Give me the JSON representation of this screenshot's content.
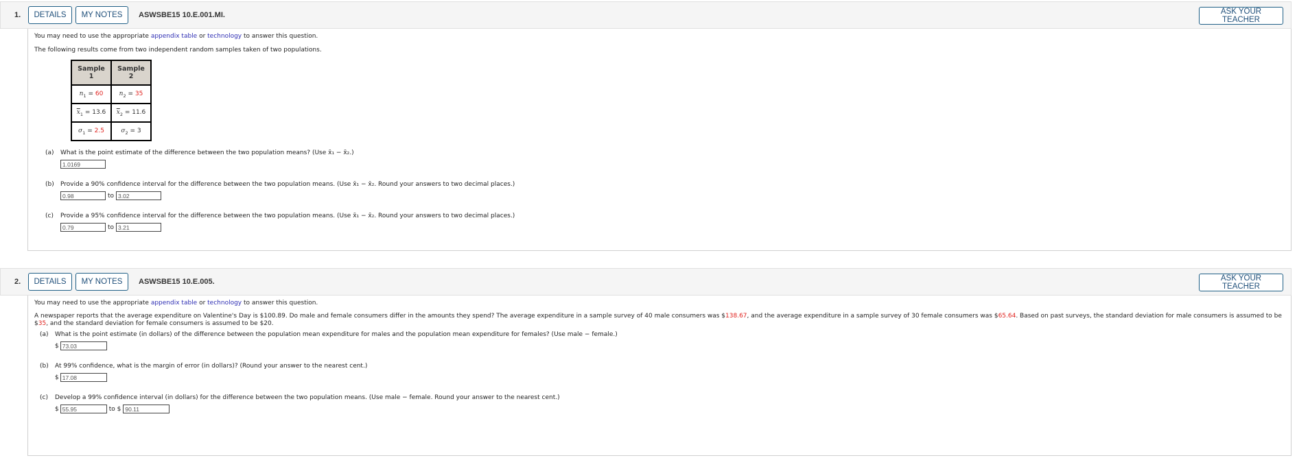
{
  "questions": [
    {
      "number": "1.",
      "details_label": "DETAILS",
      "notes_label": "MY NOTES",
      "id": "ASWSBE15 10.E.001.MI.",
      "ask_label": "ASK YOUR TEACHER",
      "intro_pre": "You may need to use the appropriate ",
      "intro_link1": "appendix table",
      "intro_mid": " or ",
      "intro_link2": "technology",
      "intro_post": " to answer this question.",
      "statement": "The following results come from two independent random samples taken of two populations.",
      "table": {
        "headers": [
          "Sample 1",
          "Sample 2"
        ],
        "rows": [
          {
            "s1_sym": "n",
            "s1_sub": "1",
            "s1_val": "60",
            "s1_red": true,
            "s2_sym": "n",
            "s2_sub": "2",
            "s2_val": "35",
            "s2_red": true
          },
          {
            "s1_sym": "x",
            "s1_sub": "1",
            "s1_val": "13.6",
            "s1_red": false,
            "s2_sym": "x",
            "s2_sub": "2",
            "s2_val": "11.6",
            "s2_red": false
          },
          {
            "s1_sym": "σ",
            "s1_sub": "1",
            "s1_val": "2.5",
            "s1_red": true,
            "s2_sym": "σ",
            "s2_sub": "2",
            "s2_val": "3",
            "s2_red": false
          }
        ]
      },
      "parts": [
        {
          "label": "(a)",
          "text": "What is the point estimate of the difference between the two population means? (Use x̄₁ − x̄₂.)",
          "answers": [
            "1.0169"
          ],
          "to_label": ""
        },
        {
          "label": "(b)",
          "text": "Provide a 90% confidence interval for the difference between the two population means. (Use x̄₁ − x̄₂. Round your answers to two decimal places.)",
          "answers": [
            "0.98",
            "3.02"
          ],
          "to_label": "to"
        },
        {
          "label": "(c)",
          "text": "Provide a 95% confidence interval for the difference between the two population means. (Use x̄₁ − x̄₂. Round your answers to two decimal places.)",
          "answers": [
            "0.79",
            "3.21"
          ],
          "to_label": "to"
        }
      ]
    },
    {
      "number": "2.",
      "details_label": "DETAILS",
      "notes_label": "MY NOTES",
      "id": "ASWSBE15 10.E.005.",
      "ask_label": "ASK YOUR TEACHER",
      "intro_pre": "You may need to use the appropriate ",
      "intro_link1": "appendix table",
      "intro_mid": " or ",
      "intro_link2": "technology",
      "intro_post": " to answer this question.",
      "statement_parts": {
        "p1": "A newspaper reports that the average expenditure on Valentine's Day is $100.89. Do male and female consumers differ in the amounts they spend? The average expenditure in a sample survey of 40 male consumers was $",
        "v1": "138.67",
        "p2": ", and the average expenditure in a sample survey of 30 female consumers was $",
        "v2": "65.64",
        "p3": ". Based on past surveys, the standard deviation for male consumers is assumed to be $",
        "v3": "35",
        "p4": ", and the standard deviation for female consumers is assumed to be $20."
      },
      "parts": [
        {
          "label": "(a)",
          "text": "What is the point estimate (in dollars) of the difference between the population mean expenditure for males and the population mean expenditure for females? (Use male − female.)",
          "currency": "$",
          "answers": [
            "73.03"
          ]
        },
        {
          "label": "(b)",
          "text": "At 99% confidence, what is the margin of error (in dollars)? (Round your answer to the nearest cent.)",
          "currency": "$",
          "answers": [
            "17.08"
          ]
        },
        {
          "label": "(c)",
          "text": "Develop a 99% confidence interval (in dollars) for the difference between the two population means. (Use male − female. Round your answer to the nearest cent.)",
          "currency": "$",
          "answers": [
            "55.95",
            "90.11"
          ],
          "to_label": "to $"
        }
      ]
    }
  ],
  "colors": {
    "button_border": "#1f5f86",
    "link": "#2d2db3",
    "highlight_red": "#e0201c",
    "header_bg": "#f5f5f5",
    "table_header_bg": "#d9d4cc"
  }
}
